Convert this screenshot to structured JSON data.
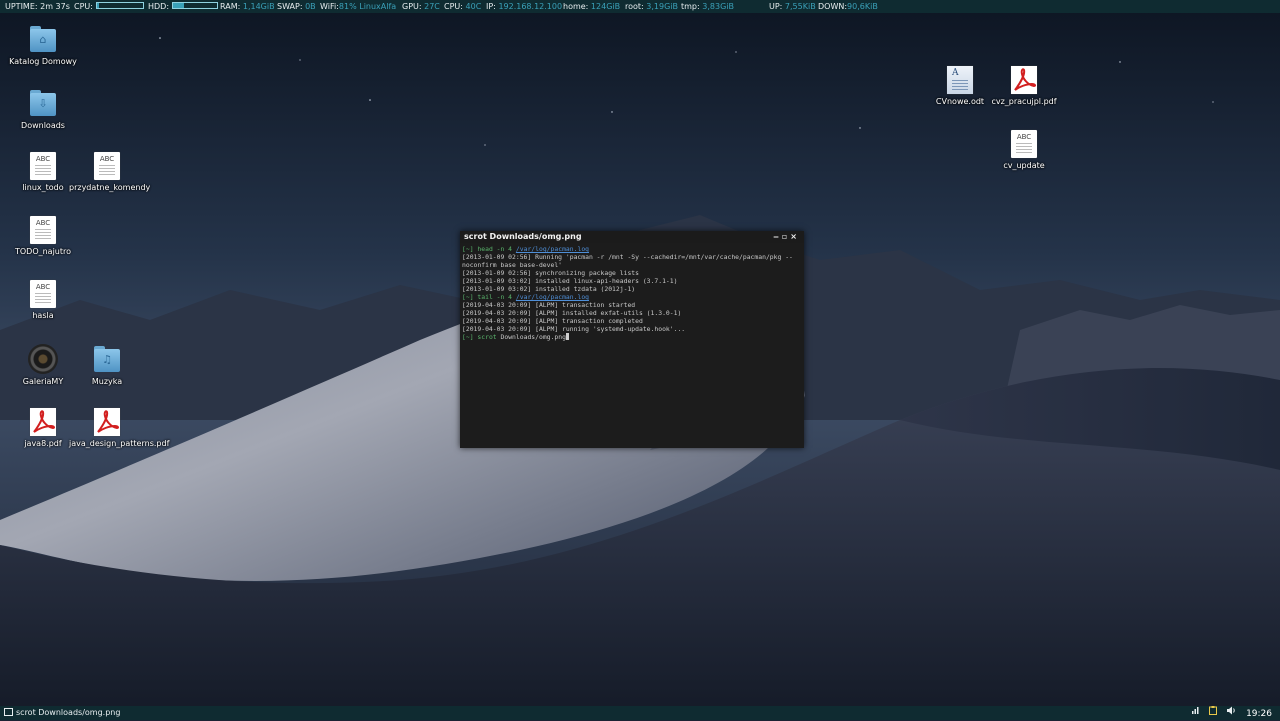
{
  "topbar": {
    "uptime_label": "UPTIME:",
    "uptime": "2m 37s",
    "cpu_label": "CPU:",
    "cpu_level": 0.05,
    "hdd_label": "HDD:",
    "hdd_level": 0.25,
    "ram_label": "RAM:",
    "ram": "1,14GiB",
    "swap_label": "SWAP:",
    "swap": "0B",
    "wifi_label": "WiFi:",
    "wifi": "81% LinuxAlfa",
    "gpu_label": "GPU:",
    "gpu_temp": "27C",
    "cpu2_label": "CPU:",
    "cpu_temp": "40C",
    "ip_label": "IP:",
    "ip": "192.168.12.100",
    "home_label": "home:",
    "home": "124GiB",
    "root_label": "root:",
    "root": "3,19GiB",
    "tmp_label": "tmp:",
    "tmp": "3,83GiB",
    "up_label": "UP:",
    "up": "7,55KiB",
    "down_label": "DOWN:",
    "down": "90,6KiB",
    "value_color": "#3aa0b8"
  },
  "desktop_icons": {
    "katalog": {
      "label": "Katalog Domowy",
      "icon": "home-folder-icon"
    },
    "downloads": {
      "label": "Downloads",
      "icon": "downloads-folder-icon"
    },
    "linux_todo": {
      "label": "linux_todo",
      "icon": "text-document-icon",
      "abc": "ABC"
    },
    "przydatne": {
      "label": "przydatne_komendy",
      "icon": "text-document-icon",
      "abc": "ABC"
    },
    "todo": {
      "label": "TODO_najutro",
      "icon": "text-document-icon",
      "abc": "ABC"
    },
    "hasla": {
      "label": "hasla",
      "icon": "text-document-icon",
      "abc": "ABC"
    },
    "galeria": {
      "label": "GaleriaMY",
      "icon": "camera-icon"
    },
    "muzyka": {
      "label": "Muzyka",
      "icon": "music-folder-icon"
    },
    "java8": {
      "label": "java8.pdf",
      "icon": "pdf-icon"
    },
    "java_dp": {
      "label": "java_design_patterns.pdf",
      "icon": "pdf-icon"
    },
    "cvnowe": {
      "label": "CVnowe.odt",
      "icon": "odt-document-icon",
      "letter": "A"
    },
    "cvz": {
      "label": "cvz_pracujpl.pdf",
      "icon": "pdf-icon"
    },
    "cv_update": {
      "label": "cv_update",
      "icon": "text-document-icon",
      "abc": "ABC"
    }
  },
  "terminal": {
    "title": "scrot Downloads/omg.png",
    "controls": "‒ ▫ ×",
    "prompt": "[~]",
    "cmd1": "head -n 4",
    "path1": "/var/log/pacman.log",
    "line1": "[2013-01-09 02:56] Running 'pacman -r /mnt -Sy --cachedir=/mnt/var/cache/pacman/pkg --noconfirm base base-devel'",
    "line2": "[2013-01-09 02:56] synchronizing package lists",
    "line3": "[2013-01-09 03:02] installed linux-api-headers (3.7.1-1)",
    "line4": "[2013-01-09 03:02] installed tzdata (2012j-1)",
    "cmd2": "tail -n 4",
    "path2": "/var/log/pacman.log",
    "line5": "[2019-04-03 20:09] [ALPM] transaction started",
    "line6": "[2019-04-03 20:09] [ALPM] installed exfat-utils (1.3.0-1)",
    "line7": "[2019-04-03 20:09] [ALPM] transaction completed",
    "line8": "[2019-04-03 20:09] [ALPM] running 'systemd-update.hook'...",
    "cmd3_name": "scrot",
    "cmd3_arg": "Downloads/omg.png"
  },
  "taskbar": {
    "task_label": "scrot Downloads/omg.png",
    "clock": "19:26",
    "tray_icons": [
      "network-icon",
      "clipboard-icon",
      "volume-icon"
    ]
  }
}
